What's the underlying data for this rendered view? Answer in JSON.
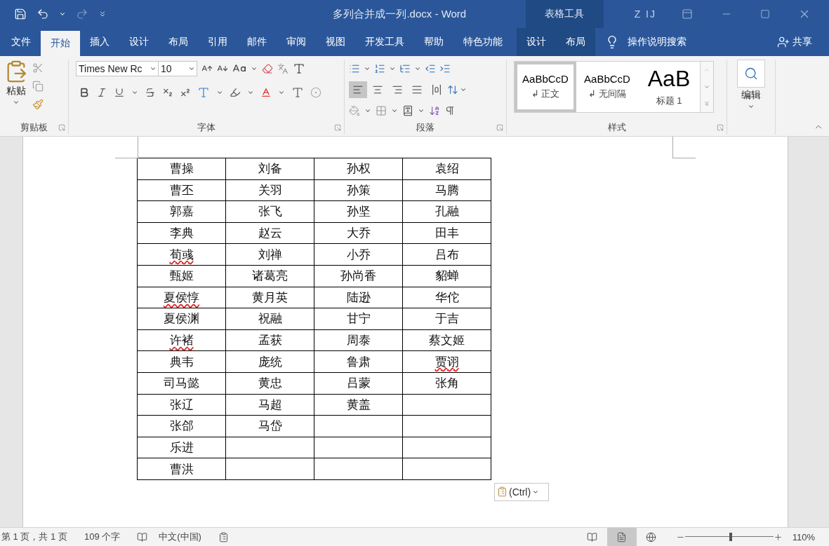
{
  "title_bar": {
    "title": "多列合并成一列.docx  -  Word",
    "context_group": "表格工具",
    "user": "Z IJ"
  },
  "tabs": [
    {
      "label": "文件",
      "selected": false,
      "kind": "main"
    },
    {
      "label": "开始",
      "selected": true,
      "kind": "main"
    },
    {
      "label": "插入",
      "selected": false,
      "kind": "main"
    },
    {
      "label": "设计",
      "selected": false,
      "kind": "main"
    },
    {
      "label": "布局",
      "selected": false,
      "kind": "main"
    },
    {
      "label": "引用",
      "selected": false,
      "kind": "main"
    },
    {
      "label": "邮件",
      "selected": false,
      "kind": "main"
    },
    {
      "label": "审阅",
      "selected": false,
      "kind": "main"
    },
    {
      "label": "视图",
      "selected": false,
      "kind": "main"
    },
    {
      "label": "开发工具",
      "selected": false,
      "kind": "main"
    },
    {
      "label": "帮助",
      "selected": false,
      "kind": "main"
    },
    {
      "label": "特色功能",
      "selected": false,
      "kind": "main"
    },
    {
      "label": "设计",
      "selected": false,
      "kind": "contextual"
    },
    {
      "label": "布局",
      "selected": false,
      "kind": "contextual"
    }
  ],
  "tell_me": {
    "placeholder": "操作说明搜索"
  },
  "share": "共享",
  "ribbon": {
    "clipboard": {
      "paste": "粘贴",
      "label": "剪贴板"
    },
    "font": {
      "font_name": "Times New Rc",
      "font_size": "10",
      "label": "字体"
    },
    "paragraph": {
      "label": "段落",
      "align_buttons": [
        {
          "kind": "left",
          "selected": true
        },
        {
          "kind": "center",
          "selected": false
        },
        {
          "kind": "right",
          "selected": false
        },
        {
          "kind": "justify",
          "selected": false
        },
        {
          "kind": "distributed",
          "selected": false
        }
      ]
    },
    "styles": {
      "label": "样式",
      "items": [
        {
          "preview": "AaBbCcD",
          "name": "↲ 正文",
          "kind": "normal",
          "selected": true
        },
        {
          "preview": "AaBbCcD",
          "name": "↲ 无间隔",
          "kind": "normal",
          "selected": false
        },
        {
          "preview": "AaB",
          "name": "标题 1",
          "kind": "heading",
          "selected": false
        }
      ]
    },
    "editing": {
      "label": "编辑"
    }
  },
  "table": {
    "rows": [
      [
        {
          "text": "曹操"
        },
        {
          "text": "刘备"
        },
        {
          "text": "孙权"
        },
        {
          "text": "袁绍"
        }
      ],
      [
        {
          "text": "曹丕"
        },
        {
          "text": "关羽"
        },
        {
          "text": "孙策"
        },
        {
          "text": "马腾"
        }
      ],
      [
        {
          "text": "郭嘉"
        },
        {
          "text": "张飞"
        },
        {
          "text": "孙坚"
        },
        {
          "text": "孔融"
        }
      ],
      [
        {
          "text": "李典"
        },
        {
          "text": "赵云"
        },
        {
          "text": "大乔"
        },
        {
          "text": "田丰"
        }
      ],
      [
        {
          "text": "荀彧",
          "spell_error": true
        },
        {
          "text": "刘禅"
        },
        {
          "text": "小乔"
        },
        {
          "text": "吕布"
        }
      ],
      [
        {
          "text": "甄姬"
        },
        {
          "text": "诸葛亮"
        },
        {
          "text": "孙尚香"
        },
        {
          "text": "貂蝉"
        }
      ],
      [
        {
          "text": "夏侯惇",
          "spell_error": true
        },
        {
          "text": "黄月英"
        },
        {
          "text": "陆逊"
        },
        {
          "text": "华佗"
        }
      ],
      [
        {
          "text": "夏侯渊"
        },
        {
          "text": "祝融"
        },
        {
          "text": "甘宁"
        },
        {
          "text": "于吉"
        }
      ],
      [
        {
          "text": "许褚",
          "spell_error": true
        },
        {
          "text": "孟获"
        },
        {
          "text": "周泰"
        },
        {
          "text": "蔡文姬"
        }
      ],
      [
        {
          "text": "典韦"
        },
        {
          "text": "庞统"
        },
        {
          "text": "鲁肃"
        },
        {
          "text": "贾诩",
          "spell_error": true
        }
      ],
      [
        {
          "text": "司马懿"
        },
        {
          "text": "黄忠"
        },
        {
          "text": "吕蒙"
        },
        {
          "text": "张角"
        }
      ],
      [
        {
          "text": "张辽"
        },
        {
          "text": "马超"
        },
        {
          "text": "黄盖"
        }
      ],
      [
        {
          "text": "张郃"
        },
        {
          "text": "马岱"
        }
      ],
      [
        {
          "text": "乐进"
        }
      ],
      [
        {
          "text": "曹洪"
        }
      ]
    ]
  },
  "paste_options": "(Ctrl)",
  "status_bar": {
    "page": "第 1 页，共 1 页",
    "words": "109 个字",
    "language": "中文(中国)",
    "views": [
      {
        "kind": "read",
        "selected": false
      },
      {
        "kind": "print",
        "selected": true
      },
      {
        "kind": "web",
        "selected": false
      }
    ],
    "zoom": {
      "level": 0.52,
      "reading": "110%"
    }
  }
}
